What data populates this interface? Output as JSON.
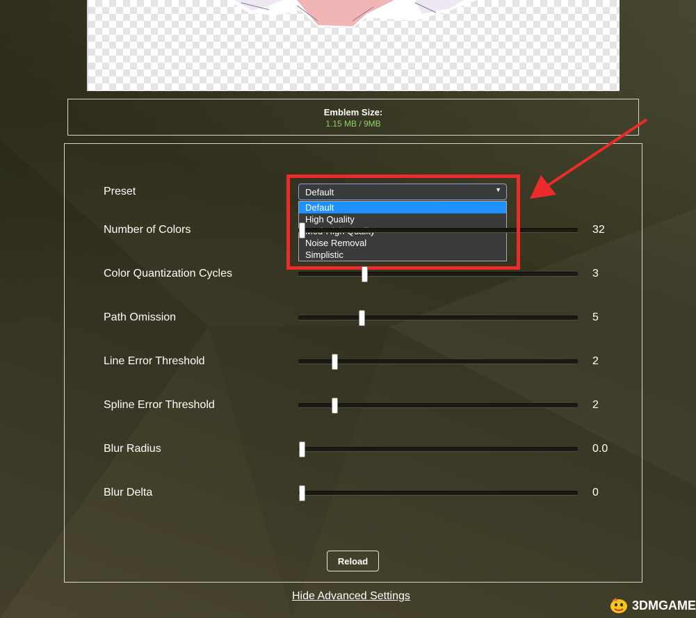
{
  "emblem": {
    "title": "Emblem Size:",
    "value": "1.15 MB / 9MB",
    "value_color": "#8fd46a"
  },
  "preset": {
    "label": "Preset",
    "selected": "Default",
    "options": [
      "Default",
      "High Quality",
      "Med-High Quality",
      "Noise Removal",
      "Simplistic"
    ]
  },
  "sliders": [
    {
      "label": "Number of Colors",
      "value": "32",
      "fraction": 0.0
    },
    {
      "label": "Color Quantization Cycles",
      "value": "3",
      "fraction": 0.23
    },
    {
      "label": "Path Omission",
      "value": "5",
      "fraction": 0.22
    },
    {
      "label": "Line Error Threshold",
      "value": "2",
      "fraction": 0.12
    },
    {
      "label": "Spline Error Threshold",
      "value": "2",
      "fraction": 0.12
    },
    {
      "label": "Blur Radius",
      "value": "0.0",
      "fraction": 0.0
    },
    {
      "label": "Blur Delta",
      "value": "0",
      "fraction": 0.0
    }
  ],
  "buttons": {
    "reload": "Reload"
  },
  "links": {
    "hide_advanced": "Hide Advanced Settings"
  },
  "watermark": {
    "text": "3DMGAME"
  },
  "colors": {
    "highlight": "#ec2c2c",
    "dropdown_active": "#1e90ff"
  }
}
